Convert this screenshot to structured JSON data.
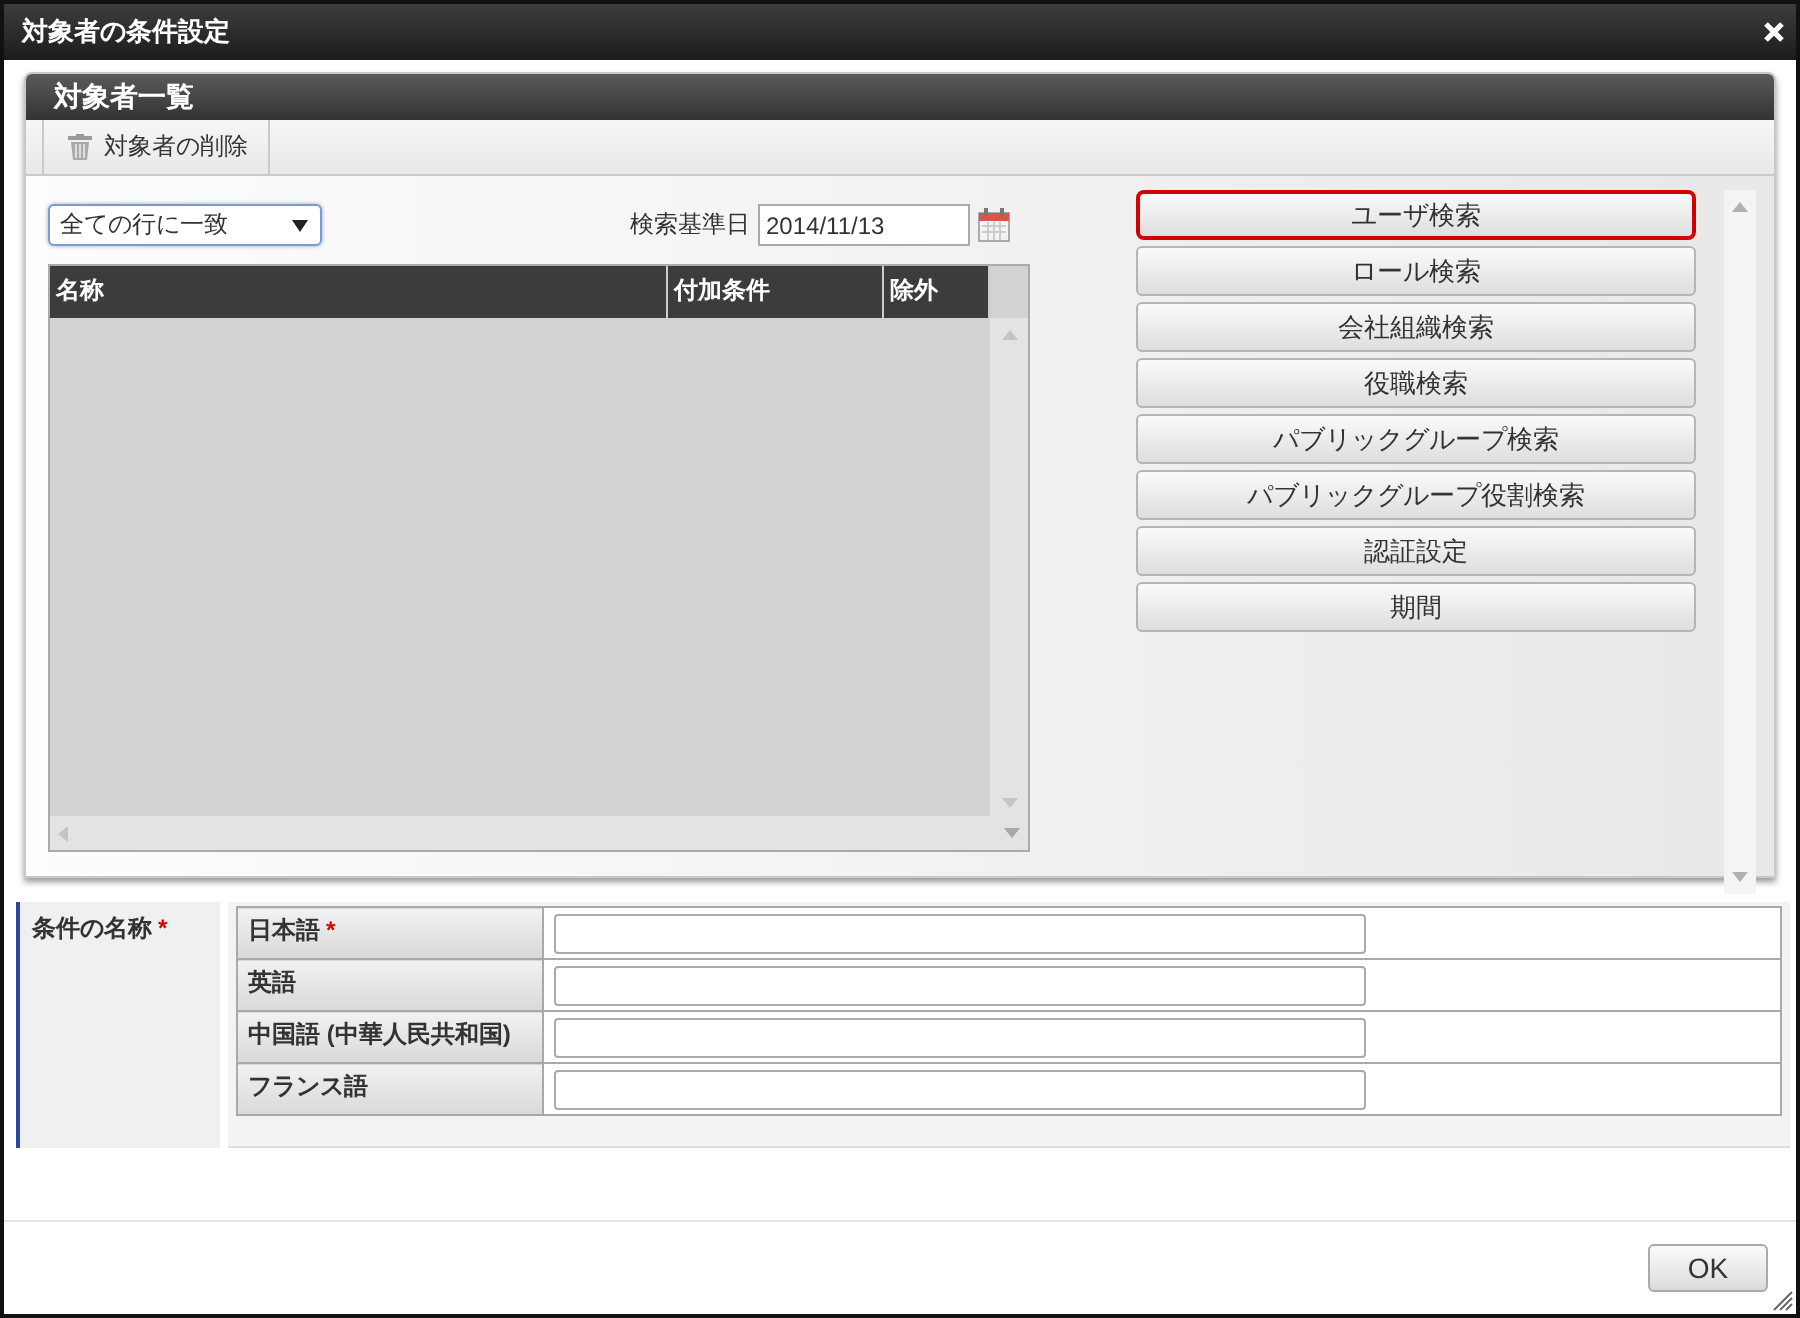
{
  "window": {
    "title": "対象者の条件設定"
  },
  "panel": {
    "title": "対象者一覧",
    "toolbar": [
      {
        "label": "対象者の削除",
        "kind": "delete"
      }
    ]
  },
  "match_select": {
    "value": "全ての行に一致"
  },
  "base_date": {
    "label": "検索基準日",
    "value": "2014/11/13"
  },
  "table": {
    "columns": [
      "名称",
      "付加条件",
      "除外"
    ]
  },
  "search_buttons": [
    {
      "label": "ユーザ検索",
      "highlighted": true
    },
    {
      "label": "ロール検索",
      "highlighted": false
    },
    {
      "label": "会社組織検索",
      "highlighted": false
    },
    {
      "label": "役職検索",
      "highlighted": false
    },
    {
      "label": "パブリックグループ検索",
      "highlighted": false
    },
    {
      "label": "パブリックグループ役割検索",
      "highlighted": false
    },
    {
      "label": "認証設定",
      "highlighted": false
    },
    {
      "label": "期間",
      "highlighted": false
    }
  ],
  "condition_name": {
    "label": "条件の名称",
    "required_mark": "*",
    "languages": [
      {
        "label": "日本語",
        "required_mark": "*"
      },
      {
        "label": "英語"
      },
      {
        "label": "中国語 (中華人民共和国)"
      },
      {
        "label": "フランス語"
      }
    ]
  },
  "footer": {
    "buttons": [
      "OK"
    ]
  }
}
